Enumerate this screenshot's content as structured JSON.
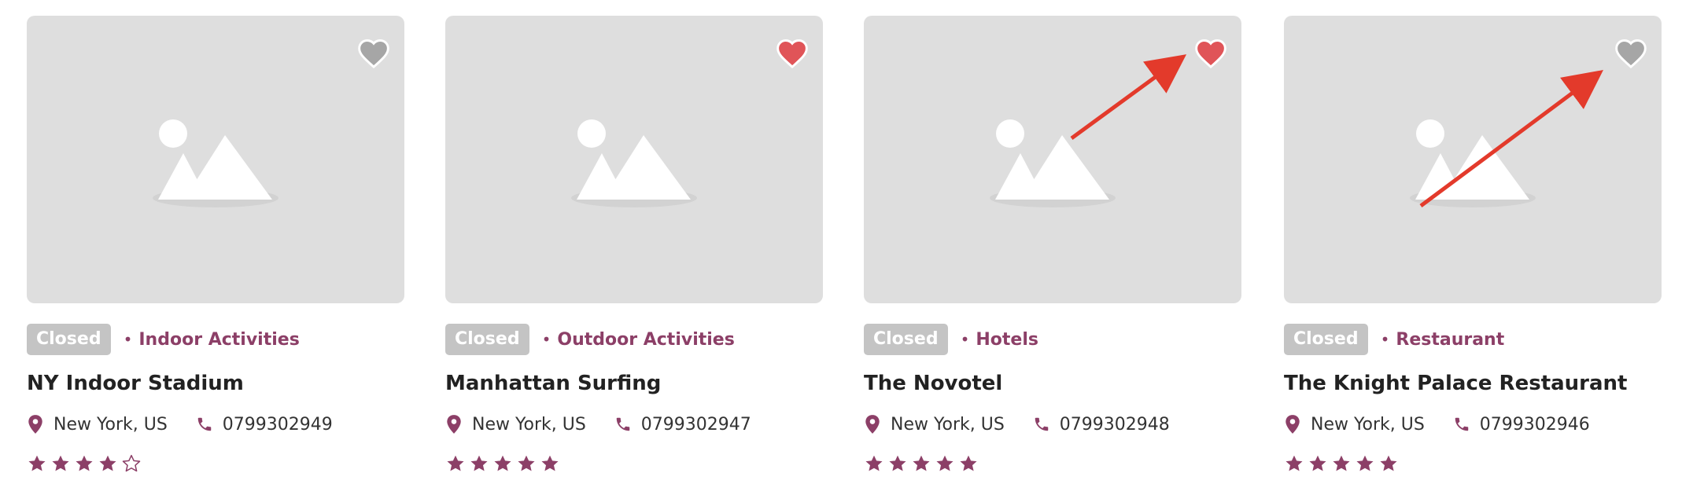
{
  "colors": {
    "accent": "#8c3f67",
    "favorite_active": "#e05458",
    "favorite_inactive": "#a6a6a6",
    "badge_bg": "#c4c4c4",
    "thumb_bg": "#dedede",
    "annotation_arrow": "#e33a2b"
  },
  "icons": {
    "favorite": "heart-icon",
    "location": "map-pin-icon",
    "phone": "phone-icon",
    "rating": "star-icon",
    "image": "image-placeholder-icon"
  },
  "listings": [
    {
      "status": "Closed",
      "category": "Indoor Activities",
      "title": "NY Indoor Stadium",
      "location": "New York, US",
      "phone": "0799302949",
      "rating": 4,
      "favorited": false
    },
    {
      "status": "Closed",
      "category": "Outdoor Activities",
      "title": "Manhattan Surfing",
      "location": "New York, US",
      "phone": "0799302947",
      "rating": 5,
      "favorited": true
    },
    {
      "status": "Closed",
      "category": "Hotels",
      "title": "The Novotel",
      "location": "New York, US",
      "phone": "0799302948",
      "rating": 5,
      "favorited": true
    },
    {
      "status": "Closed",
      "category": "Restaurant",
      "title": "The Knight Palace Restaurant",
      "location": "New York, US",
      "phone": "0799302946",
      "rating": 5,
      "favorited": false
    }
  ]
}
